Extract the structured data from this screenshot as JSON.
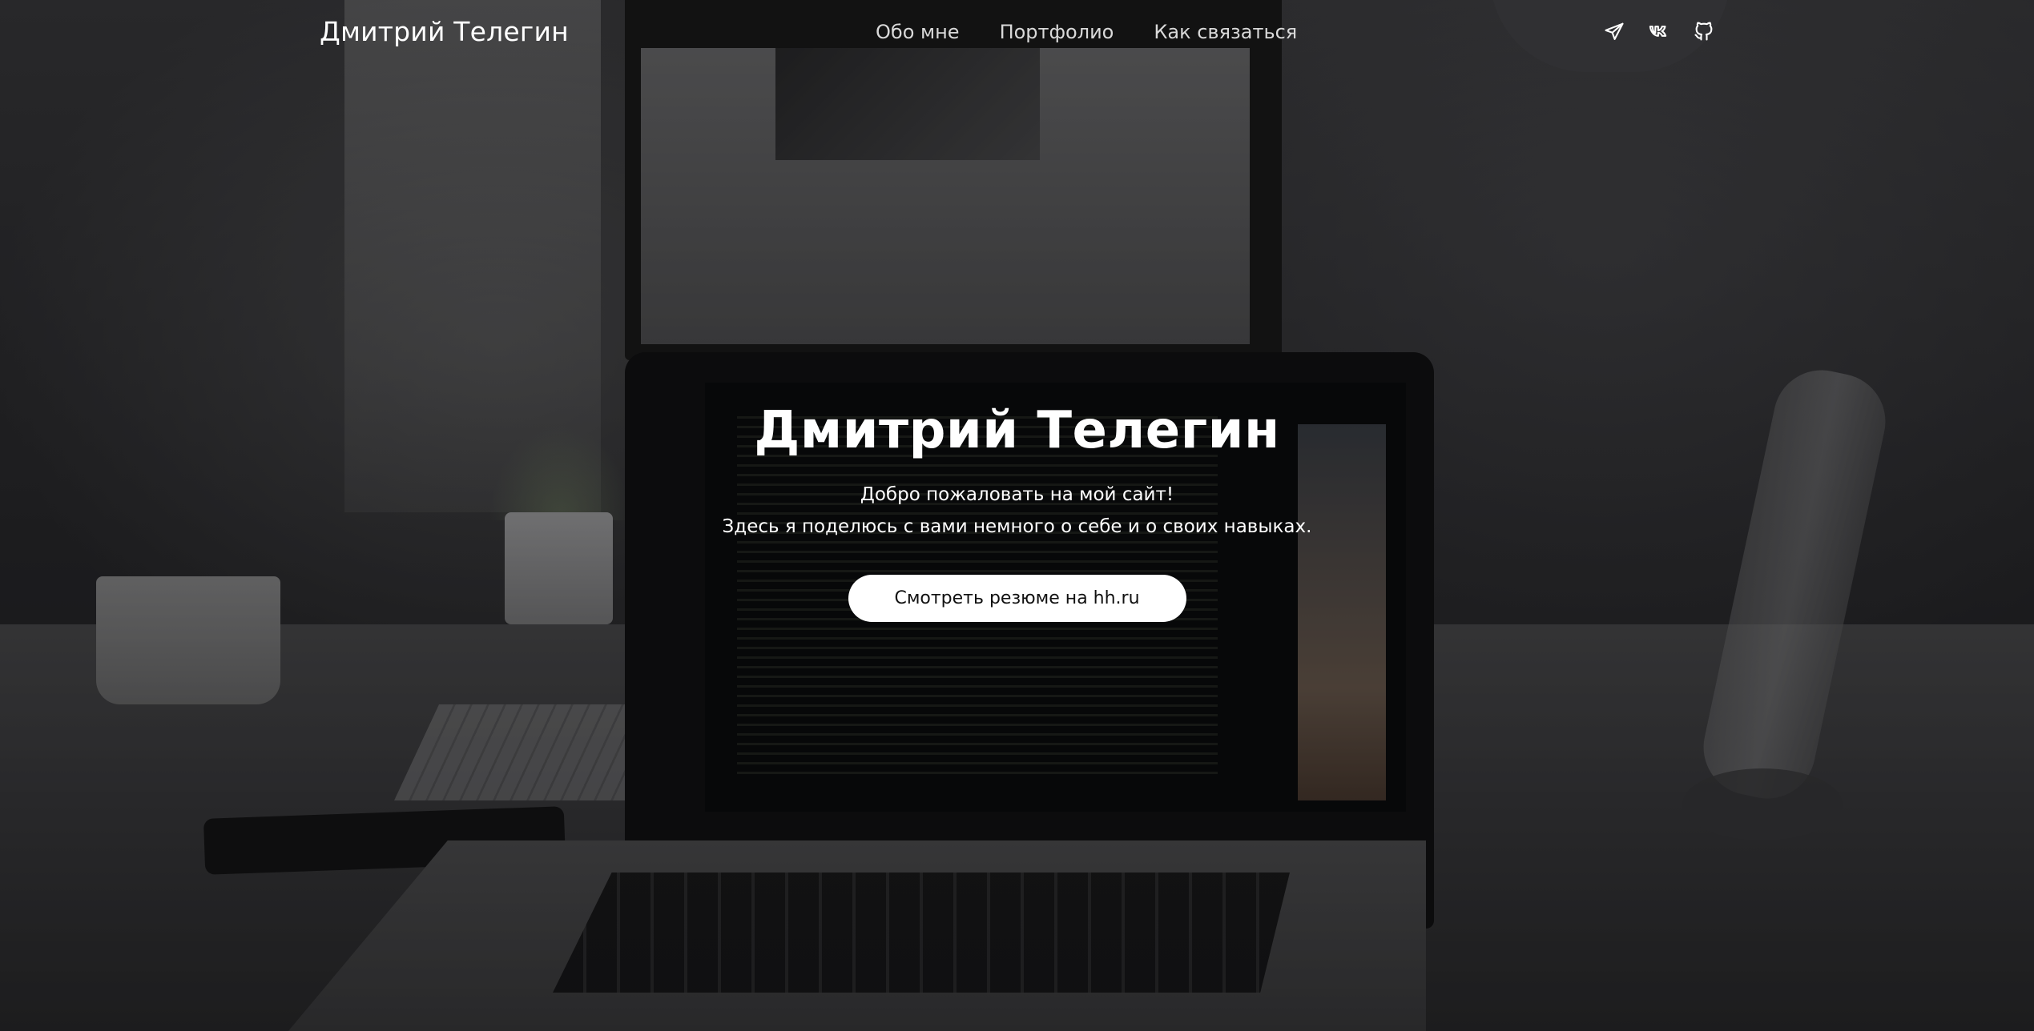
{
  "header": {
    "brand": "Дмитрий Телегин",
    "nav": [
      {
        "label": "Обо мне"
      },
      {
        "label": "Портфолио"
      },
      {
        "label": "Как связаться"
      }
    ],
    "socials": [
      {
        "icon": "telegram-icon"
      },
      {
        "icon": "vk-icon"
      },
      {
        "icon": "github-icon"
      }
    ]
  },
  "hero": {
    "title": "Дмитрий Телегин",
    "line1": "Добро пожаловать на мой сайт!",
    "line2": "Здесь я поделюсь с вами немного о себе и о своих навыках.",
    "cta_label": "Смотреть резюме на hh.ru"
  },
  "colors": {
    "text": "#ffffff",
    "nav_text": "#d9d9d9",
    "button_bg": "#ffffff",
    "button_text": "#111111"
  }
}
